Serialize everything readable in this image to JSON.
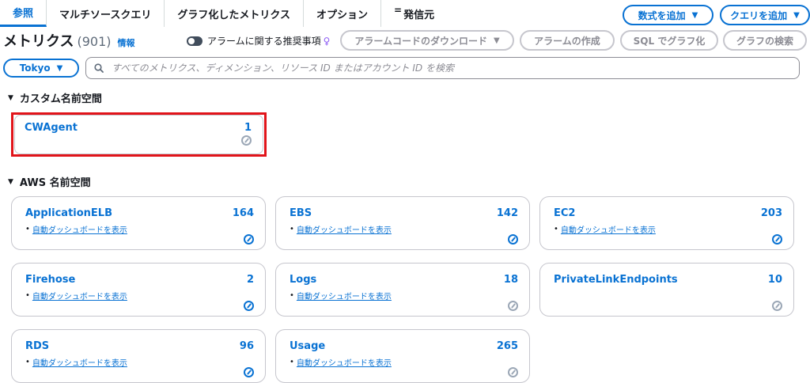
{
  "tabs": [
    {
      "label": "参照",
      "active": true
    },
    {
      "label": "マルチソースクエリ"
    },
    {
      "label": "グラフ化したメトリクス"
    },
    {
      "label": "オプション"
    },
    {
      "label": "発信元",
      "icon": "equals-icon"
    }
  ],
  "buttons": {
    "add_formula": "数式を追加",
    "add_query": "クエリを追加",
    "download_alarm_code": "アラームコードのダウンロード",
    "create_alarm": "アラームの作成",
    "graph_with_sql": "SQL でグラフ化",
    "search_graph": "グラフの検索"
  },
  "header": {
    "title": "メトリクス",
    "count": "(901)",
    "info_link": "情報",
    "toggle_label": "アラームに関する推奨事項"
  },
  "region": "Tokyo",
  "search": {
    "placeholder": "すべてのメトリクス、ディメンション、リソース ID またはアカウント ID を検索"
  },
  "custom_namespaces": {
    "heading": "カスタム名前空間",
    "items": [
      {
        "name": "CWAgent",
        "count": "1"
      }
    ]
  },
  "aws_namespaces": {
    "heading": "AWS 名前空間",
    "dashboard_link": "自動ダッシュボードを表示",
    "items": [
      {
        "name": "ApplicationELB",
        "count": "164",
        "dashboard": true,
        "icon_active": true
      },
      {
        "name": "EBS",
        "count": "142",
        "dashboard": true,
        "icon_active": true
      },
      {
        "name": "EC2",
        "count": "203",
        "dashboard": true,
        "icon_active": true
      },
      {
        "name": "Firehose",
        "count": "2",
        "dashboard": true,
        "icon_active": true
      },
      {
        "name": "Logs",
        "count": "18",
        "dashboard": true,
        "icon_active": false
      },
      {
        "name": "PrivateLinkEndpoints",
        "count": "10",
        "dashboard": false,
        "icon_active": false
      },
      {
        "name": "RDS",
        "count": "96",
        "dashboard": true,
        "icon_active": true
      },
      {
        "name": "Usage",
        "count": "265",
        "dashboard": true,
        "icon_active": false
      }
    ]
  },
  "colors": {
    "accent": "#0972d3",
    "highlight": "#e1141a"
  }
}
